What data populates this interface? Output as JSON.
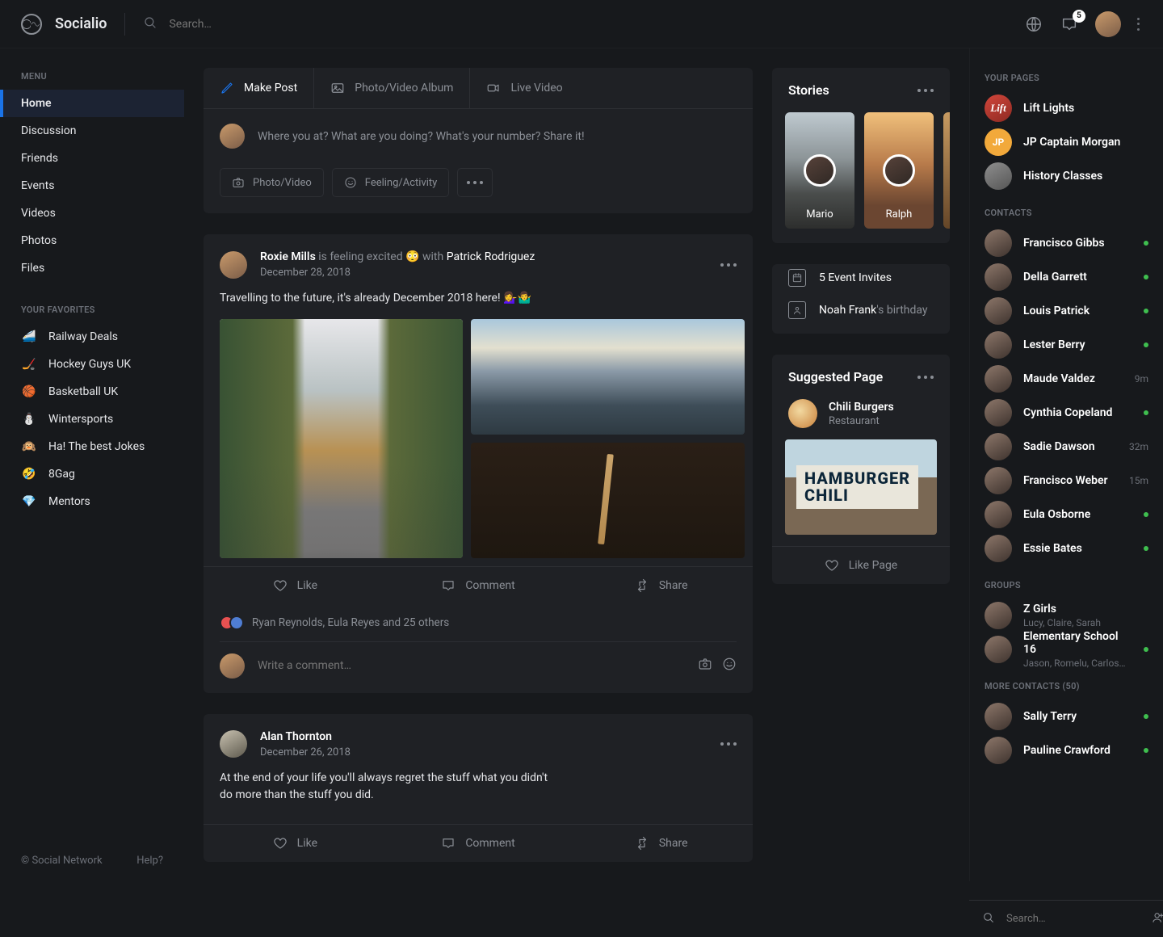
{
  "header": {
    "brand": "Socialio",
    "search_placeholder": "Search…",
    "notif_count": "5"
  },
  "left": {
    "menu_label": "MENU",
    "menu_items": [
      "Home",
      "Discussion",
      "Friends",
      "Events",
      "Videos",
      "Photos",
      "Files"
    ],
    "active_index": 0,
    "fav_label": "YOUR FAVORITES",
    "favorites": [
      {
        "icon": "🚄",
        "label": "Railway Deals"
      },
      {
        "icon": "🏒",
        "label": "Hockey Guys UK"
      },
      {
        "icon": "🏀",
        "label": "Basketball UK"
      },
      {
        "icon": "⛄",
        "label": "Wintersports"
      },
      {
        "icon": "🙉",
        "label": "Ha! The best Jokes"
      },
      {
        "icon": "🤣",
        "label": "8Gag"
      },
      {
        "icon": "💎",
        "label": "Mentors"
      }
    ],
    "footer_left": "© Social Network",
    "footer_right": "Help?"
  },
  "composer": {
    "tabs": [
      "Make Post",
      "Photo/Video Album",
      "Live Video"
    ],
    "prompt": "Where you at? What are you doing? What's your number? Share it!",
    "chip_photo": "Photo/Video",
    "chip_feeling": "Feeling/Activity"
  },
  "posts": [
    {
      "author": "Roxie Mills",
      "meta": " is feeling excited 😳 with ",
      "with": "Patrick Rodriguez",
      "date": "December 28, 2018",
      "text": "Travelling to the future, it's already December 2018 here! 💁‍♀️🤷‍♂️",
      "like": "Like",
      "comment": "Comment",
      "share": "Share",
      "likes_text": "Ryan Reynolds, Eula Reyes and 25 others",
      "comment_placeholder": "Write a comment…"
    },
    {
      "author": "Alan Thornton",
      "date": "December 26, 2018",
      "text": "At the end of your life you'll always regret the stuff what you didn't do more than the stuff you did.",
      "like": "Like",
      "comment": "Comment",
      "share": "Share"
    }
  ],
  "stories": {
    "title": "Stories",
    "items": [
      "Mario",
      "Ralph"
    ]
  },
  "events": {
    "invites": "5 Event Invites",
    "bday_name": "Noah Frank",
    "bday_suffix": "'s birthday"
  },
  "suggested": {
    "title": "Suggested Page",
    "name": "Chili Burgers",
    "category": "Restaurant",
    "like": "Like Page"
  },
  "right": {
    "pages_label": "YOUR PAGES",
    "pages": [
      {
        "name": "Lift Lights",
        "variant": "red",
        "initials": "Lift"
      },
      {
        "name": "JP Captain Morgan",
        "variant": "yellow",
        "initials": "JP"
      },
      {
        "name": "History Classes",
        "variant": "grey",
        "initials": ""
      }
    ],
    "contacts_label": "CONTACTS",
    "contacts": [
      {
        "name": "Francisco Gibbs",
        "status": "online"
      },
      {
        "name": "Della Garrett",
        "status": "online"
      },
      {
        "name": "Louis Patrick",
        "status": "online"
      },
      {
        "name": "Lester Berry",
        "status": "online"
      },
      {
        "name": "Maude Valdez",
        "time": "9m"
      },
      {
        "name": "Cynthia Copeland",
        "status": "online"
      },
      {
        "name": "Sadie Dawson",
        "time": "32m"
      },
      {
        "name": "Francisco Weber",
        "time": "15m"
      },
      {
        "name": "Eula Osborne",
        "status": "online"
      },
      {
        "name": "Essie Bates",
        "status": "online"
      }
    ],
    "groups_label": "GROUPS",
    "groups": [
      {
        "name": "Z Girls",
        "sub": "Lucy, Claire, Sarah"
      },
      {
        "name": "Elementary School 16",
        "sub": "Jason, Romelu, Carlos…",
        "status": "online"
      }
    ],
    "more_label": "MORE CONTACTS (50)",
    "more": [
      {
        "name": "Sally Terry",
        "status": "online"
      },
      {
        "name": "Pauline Crawford",
        "status": "online"
      }
    ],
    "search_placeholder": "Search…"
  }
}
